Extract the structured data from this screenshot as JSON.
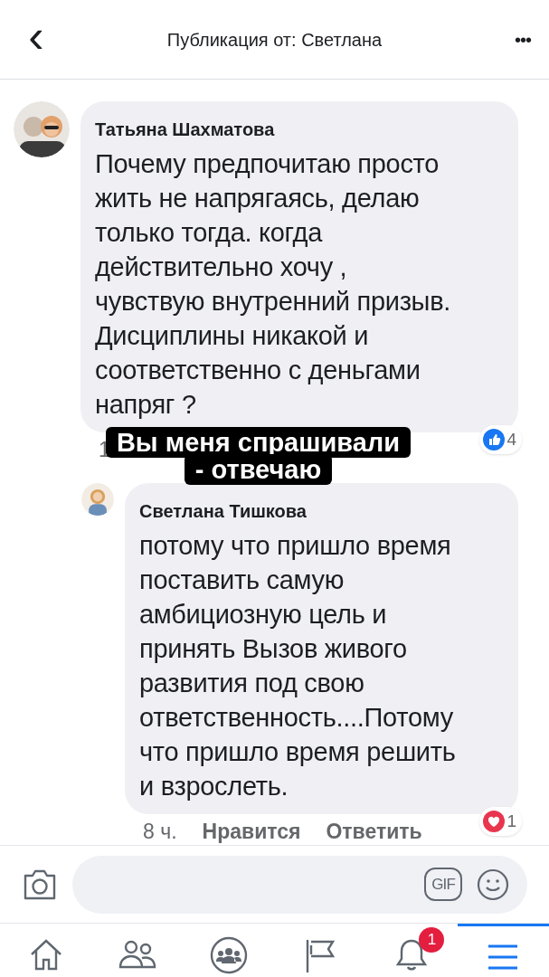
{
  "header": {
    "back": "‹",
    "title": "Публикация от: Светлана",
    "more": "•••"
  },
  "comments": [
    {
      "author": "Татьяна Шахматова",
      "lines": [
        "Почему предпочитаю просто",
        "жить не напрягаясь, делаю",
        "только тогда. когда",
        "действительно хочу ,",
        "чувствую внутренний призыв.",
        "Дисциплины никакой и",
        "соответственно с деньгами",
        "напряг ?"
      ],
      "time": "1",
      "reaction": {
        "kind": "like",
        "count": "4"
      },
      "reply_level": false
    },
    {
      "author": "Светлана Тишкова",
      "lines": [
        "потому что пришло время",
        "поставить самую",
        "амбициозную цель и",
        "принять Вызов живого",
        "развития под свою",
        "ответственность....Потому",
        "что пришло время решить",
        "и взрослеть."
      ],
      "time": "8 ч.",
      "like": "Нравится",
      "reply": "Ответить",
      "reaction": {
        "kind": "love",
        "count": "1"
      },
      "reply_level": true
    }
  ],
  "caption": [
    "Вы меня спрашивали",
    "- отвечаю"
  ],
  "composer": {
    "gif": "GIF"
  },
  "nav": [
    {
      "kind": "home",
      "selected": false
    },
    {
      "kind": "friends",
      "selected": false
    },
    {
      "kind": "groups",
      "selected": false
    },
    {
      "kind": "pages",
      "selected": false
    },
    {
      "kind": "bell",
      "selected": false,
      "badge": "1"
    },
    {
      "kind": "menu",
      "selected": true
    }
  ]
}
